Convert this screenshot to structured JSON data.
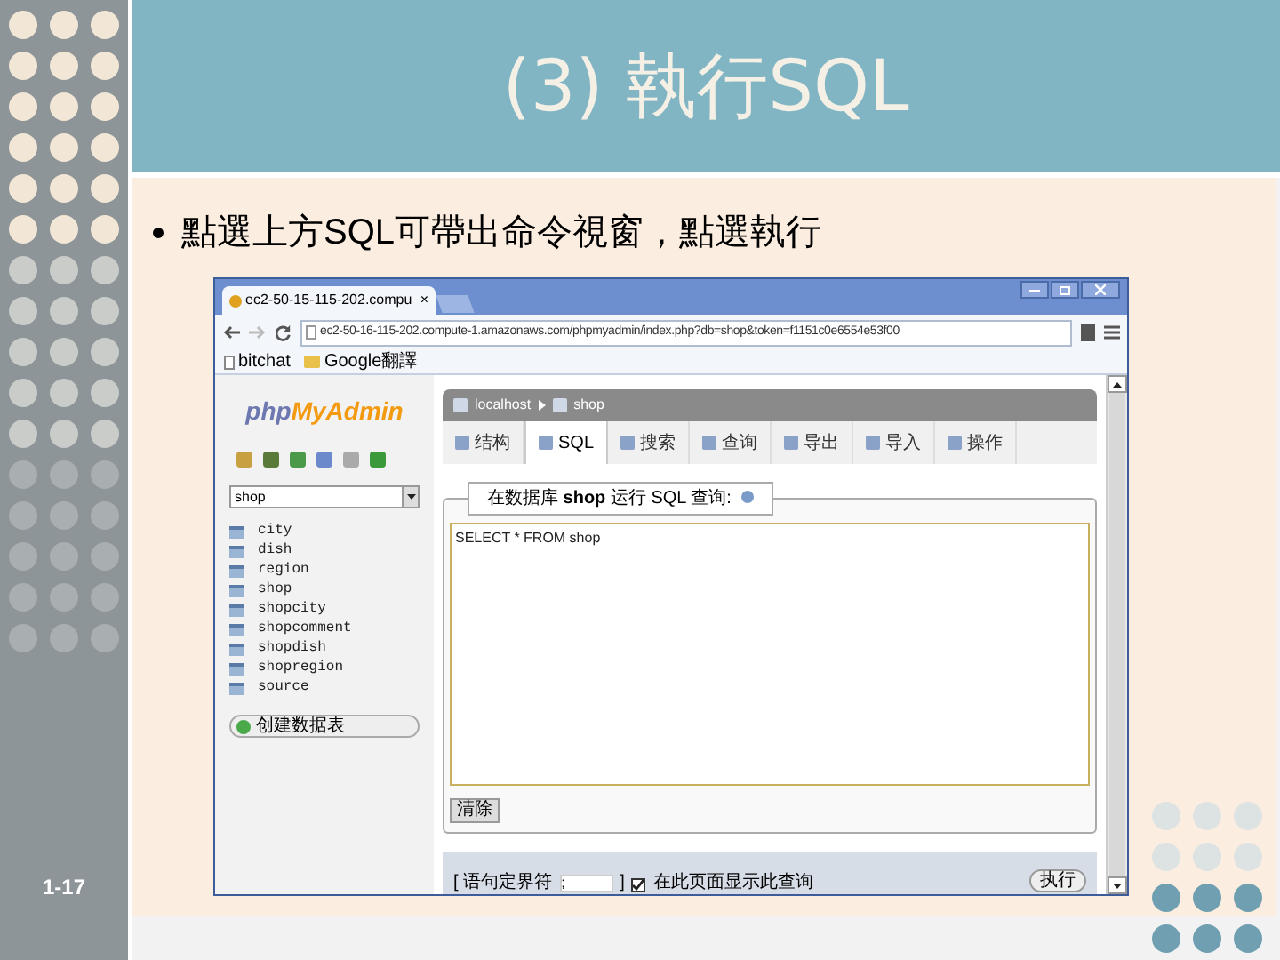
{
  "slide": {
    "title": "(3) 執行SQL",
    "bullet": "點選上方SQL可帶出命令視窗，點選執行",
    "page_number": "1-17"
  },
  "browser": {
    "tab_title": "ec2-50-15-115-202.compu",
    "tab_close": "×",
    "url": "ec2-50-16-115-202.compute-1.amazonaws.com/phpmyadmin/index.php?db=shop&token=f1151c0e6554e53f00",
    "bookmarks": [
      "bitchat",
      "Google翻譯"
    ]
  },
  "sidebar": {
    "logo_php": "php",
    "logo_name": "MyAdmin",
    "db_select": "shop",
    "tables": [
      "city",
      "dish",
      "region",
      "shop",
      "shopcity",
      "shopcomment",
      "shopdish",
      "shopregion",
      "source"
    ],
    "create_button": "创建数据表"
  },
  "breadcrumb": [
    "localhost",
    "shop"
  ],
  "tabs": [
    {
      "label": "结构",
      "selected": false
    },
    {
      "label": "SQL",
      "selected": true
    },
    {
      "label": "搜索",
      "selected": false
    },
    {
      "label": "查询",
      "selected": false
    },
    {
      "label": "导出",
      "selected": false
    },
    {
      "label": "导入",
      "selected": false
    },
    {
      "label": "操作",
      "selected": false
    }
  ],
  "query": {
    "legend": "在数据库 **shop** 运行 SQL 查询:",
    "text": "SELECT * FROM shop",
    "clear_button": "清除",
    "delimiter_label": "[ 语句定界符",
    "delimiter_value": ";",
    "delimiter_end": "]",
    "show_query_checked": true,
    "show_query_label": "在此页面显示此查询",
    "go_button": "执行"
  }
}
